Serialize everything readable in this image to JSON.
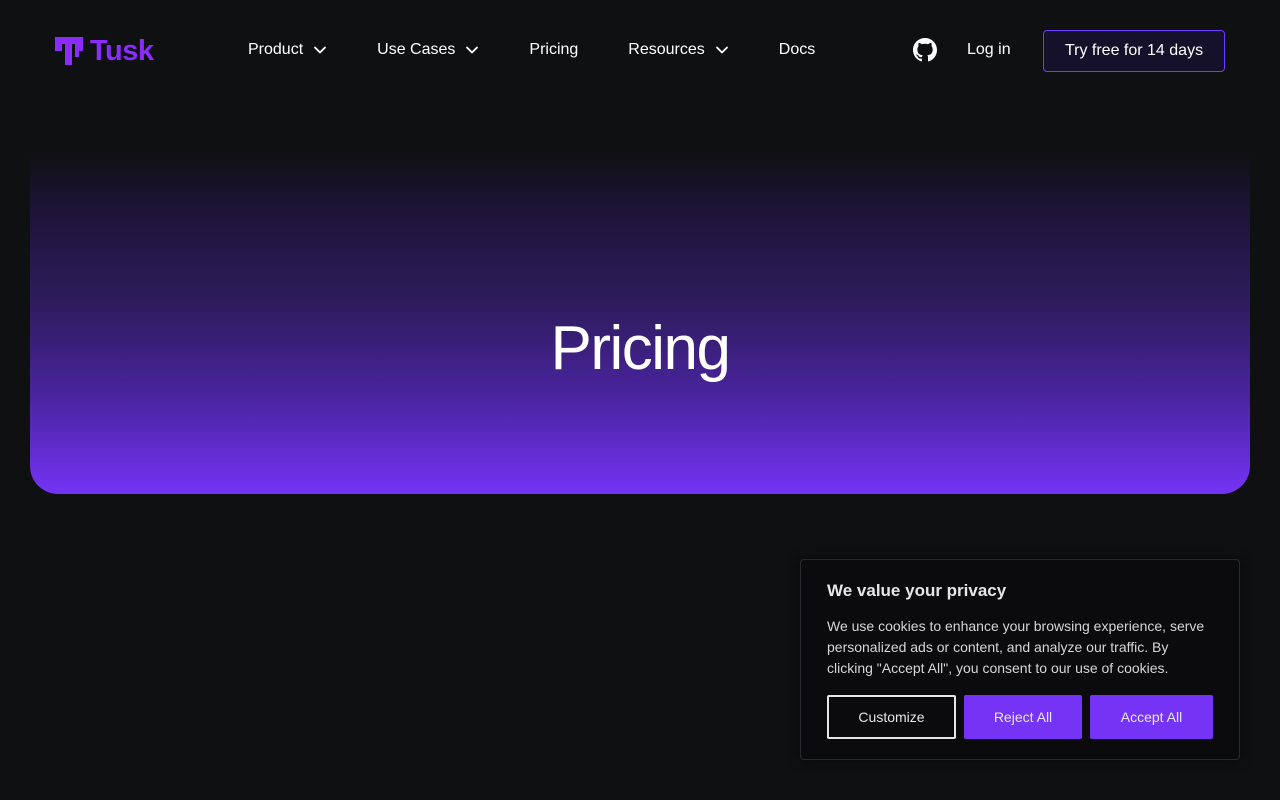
{
  "brand": {
    "name": "Tusk",
    "accent": "#8b2bff"
  },
  "nav": {
    "items": [
      {
        "label": "Product",
        "icon": "chevron-down-icon"
      },
      {
        "label": "Use Cases",
        "icon": "chevron-down-icon"
      },
      {
        "label": "Pricing"
      },
      {
        "label": "Resources",
        "icon": "chevron-down-icon"
      },
      {
        "label": "Docs"
      }
    ],
    "github_icon": "github-icon",
    "login_label": "Log in",
    "cta_label": "Try free for 14 days"
  },
  "hero": {
    "title": "Pricing"
  },
  "cookie_banner": {
    "title": "We value your privacy",
    "text": "We use cookies to enhance your browsing experience, serve personalized ads or content, and analyze our traffic. By clicking \"Accept All\", you consent to our use of cookies.",
    "customize_label": "Customize",
    "reject_label": "Reject All",
    "accept_label": "Accept All",
    "button_color": "#7533f5"
  }
}
